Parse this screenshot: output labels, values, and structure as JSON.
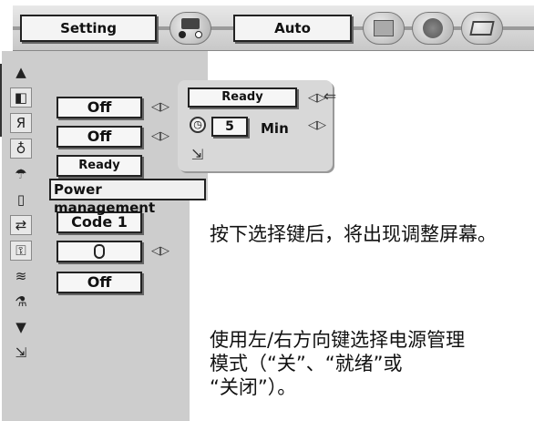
{
  "topbar": {
    "setting_label": "Setting",
    "auto_label": "Auto"
  },
  "menu": {
    "rows": [
      {
        "value": "Off",
        "arrows": "◁▷"
      },
      {
        "value": "Off",
        "arrows": "◁▷"
      },
      {
        "value": "Ready",
        "arrows": ""
      },
      {
        "value": "Code 1",
        "arrows": ""
      },
      {
        "value": "",
        "arrows": "◁▷"
      },
      {
        "value": "Off",
        "arrows": ""
      }
    ]
  },
  "tooltip": {
    "text": "Power management"
  },
  "power_panel": {
    "mode_value": "Ready",
    "mode_arrows": "◁▷",
    "timer_value": "5",
    "timer_unit": "Min",
    "timer_arrows": "◁▷"
  },
  "description": {
    "paragraph1": "按下选择键后，将出现调整屏幕。",
    "paragraph2_line1": "使用左/右方向键选择电源管理",
    "paragraph2_line2": "模式（“关”、“就绪”或",
    "paragraph2_line3": "“关闭”）。"
  }
}
